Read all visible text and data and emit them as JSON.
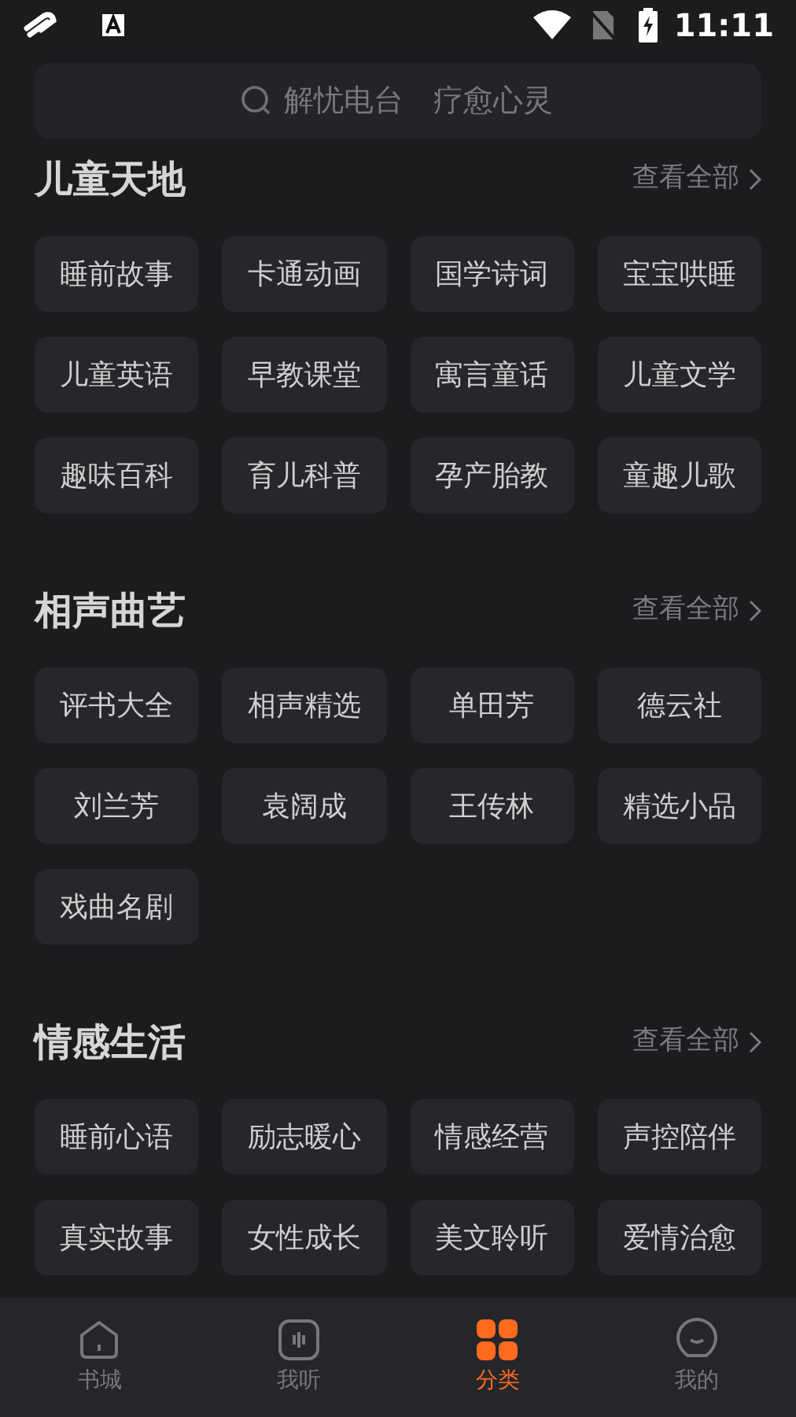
{
  "status_bar": {
    "time": "11:11"
  },
  "search": {
    "placeholder": "解忧电台　疗愈心灵"
  },
  "sections": [
    {
      "title": "儿童天地",
      "more": "查看全部",
      "tags": [
        "睡前故事",
        "卡通动画",
        "国学诗词",
        "宝宝哄睡",
        "儿童英语",
        "早教课堂",
        "寓言童话",
        "儿童文学",
        "趣味百科",
        "育儿科普",
        "孕产胎教",
        "童趣儿歌"
      ]
    },
    {
      "title": "相声曲艺",
      "more": "查看全部",
      "tags": [
        "评书大全",
        "相声精选",
        "单田芳",
        "德云社",
        "刘兰芳",
        "袁阔成",
        "王传林",
        "精选小品",
        "戏曲名剧"
      ]
    },
    {
      "title": "情感生活",
      "more": "查看全部",
      "tags": [
        "睡前心语",
        "励志暖心",
        "情感经营",
        "声控陪伴",
        "真实故事",
        "女性成长",
        "美文聆听",
        "爱情治愈"
      ]
    }
  ],
  "bottom_nav": [
    {
      "kind": "home",
      "label": "书城",
      "selected": false
    },
    {
      "kind": "listen",
      "label": "我听",
      "selected": false
    },
    {
      "kind": "category",
      "label": "分类",
      "selected": true
    },
    {
      "kind": "profile",
      "label": "我的",
      "selected": false
    }
  ]
}
